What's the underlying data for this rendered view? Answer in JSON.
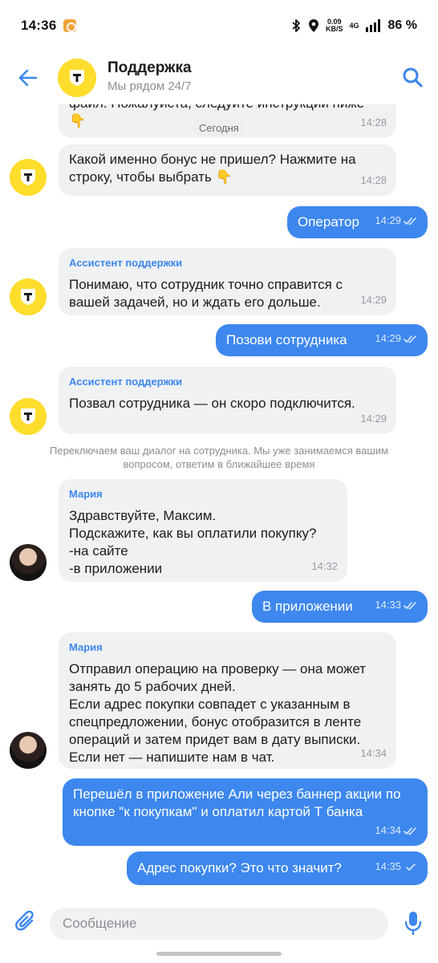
{
  "status_bar": {
    "time": "14:36",
    "speed_value": "0.09",
    "speed_unit": "KB/S",
    "network": "4G",
    "battery": "86 %",
    "icons": [
      "app-notification-icon",
      "bluetooth-icon",
      "location-icon",
      "signal-icon",
      "battery-icon"
    ]
  },
  "header": {
    "title": "Поддержка",
    "subtitle": "Мы рядом 24/7",
    "icons": [
      "back-arrow-icon",
      "t-logo-icon",
      "search-icon"
    ]
  },
  "chat": {
    "date_divider": "Сегодня",
    "system_note": "Переключаем ваш диалог на сотрудника. Мы уже занимаемся вашим вопросом, ответим в ближайшее время",
    "messages": [
      {
        "direction": "in",
        "sender": "",
        "text": "файл. Пожалуйста, следуйте инструкции ниже 👇",
        "time": "14:28"
      },
      {
        "direction": "in",
        "sender": "",
        "text": "Какой именно бонус не пришел? Нажмите на строку, чтобы выбрать 👇",
        "time": "14:28"
      },
      {
        "direction": "out",
        "text": "Оператор",
        "time": "14:29",
        "status": "read"
      },
      {
        "direction": "in",
        "sender": "Ассистент поддержки",
        "text": "Понимаю, что сотрудник точно справится с вашей задачей, но и ждать его дольше.",
        "time": "14:29"
      },
      {
        "direction": "out",
        "text": "Позови сотрудника",
        "time": "14:29",
        "status": "read"
      },
      {
        "direction": "in",
        "sender": "Ассистент поддержки",
        "text": "Позвал сотрудника — он скоро подключится.",
        "time": "14:29"
      },
      {
        "direction": "in",
        "sender": "Мария",
        "text": "Здравствуйте, Максим.\nПодскажите, как вы оплатили покупку?\n-на сайте\n-в приложении",
        "time": "14:32"
      },
      {
        "direction": "out",
        "text": "В приложении",
        "time": "14:33",
        "status": "read"
      },
      {
        "direction": "in",
        "sender": "Мария",
        "text": "Отправил операцию на проверку — она может занять до 5 рабочих дней.\nЕсли адрес покупки совпадет с указанным в спецпредложении, бонус отобразится в ленте операций и затем придет вам в дату выписки.\nЕсли нет — напишите нам в чат.",
        "time": "14:34"
      },
      {
        "direction": "out",
        "text": "Перешёл в приложение Али через баннер акции по кнопке \"к покупкам\" и оплатил картой Т банка",
        "time": "14:34",
        "status": "read"
      },
      {
        "direction": "out",
        "text": "Адрес покупки? Это что значит?",
        "time": "14:35",
        "status": "delivered"
      }
    ]
  },
  "composer": {
    "placeholder": "Сообщение",
    "value": "",
    "icons": [
      "attach-icon",
      "microphone-icon"
    ]
  },
  "colors": {
    "accent_blue": "#3d87ee",
    "brand_yellow": "#ffdd2d",
    "incoming_bubble": "#f0f1f3"
  }
}
